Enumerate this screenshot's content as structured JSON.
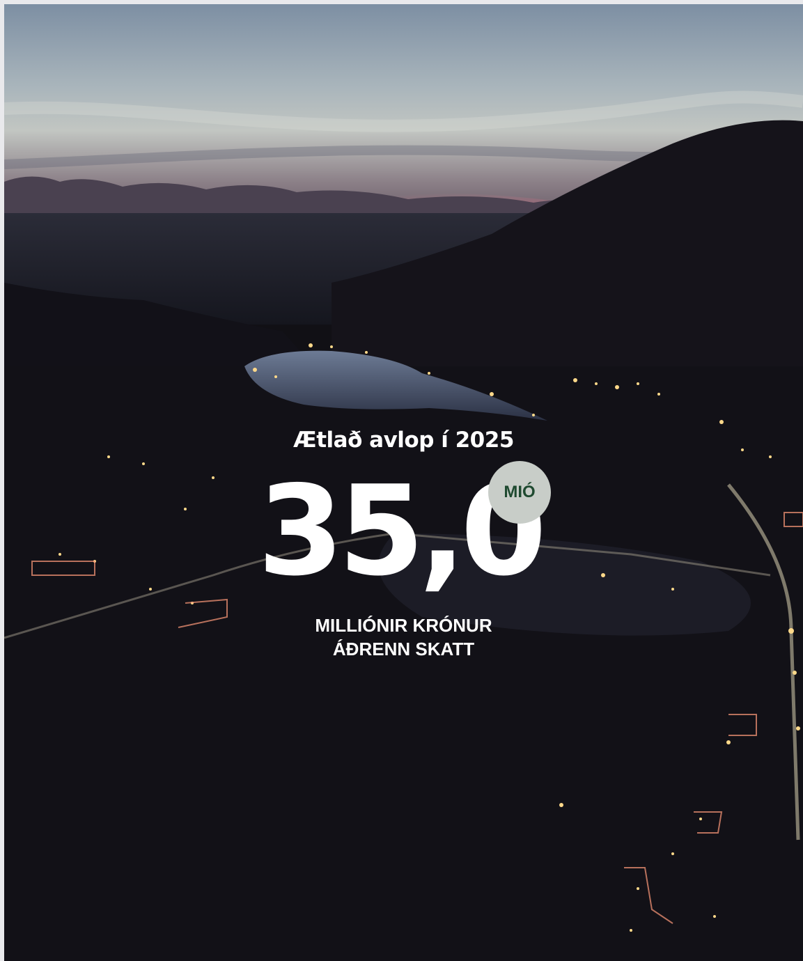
{
  "headline": "Ætlað avlop í 2025",
  "figure": {
    "value": "35,0",
    "unit_badge": "MIÓ"
  },
  "caption": {
    "line1": "MILLIÓNIR KRÓNUR",
    "line2": "ÁÐRENN SKATT"
  },
  "colors": {
    "badge_background": "#c8cdc8",
    "badge_text": "#1f4a30",
    "text": "#ffffff"
  }
}
